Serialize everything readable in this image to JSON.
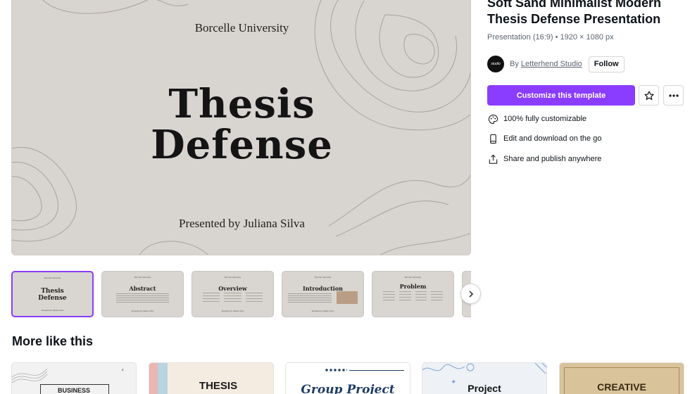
{
  "preview": {
    "university": "Borcelle University",
    "title_line1": "Thesis",
    "title_line2": "Defense",
    "presenter": "Presented by Juliana Silva"
  },
  "thumbnails": [
    {
      "header": "Borcelle University",
      "title": "Thesis Defense",
      "footer": "Presented by Juliana Silva",
      "active": true
    },
    {
      "header": "Borcelle University",
      "title": "Abstract",
      "footer": "Presented by Juliana Silva"
    },
    {
      "header": "Borcelle University",
      "title": "Overview",
      "footer": "Presented by Juliana Silva"
    },
    {
      "header": "Borcelle University",
      "title": "Introduction",
      "footer": "Presented by Juliana Silva"
    },
    {
      "header": "Borcelle University",
      "title": "Problem",
      "footer": ""
    }
  ],
  "more": {
    "heading": "More like this",
    "cards": [
      {
        "label": "BUSINESS",
        "bg": "#f2f2f2",
        "color": "#222222"
      },
      {
        "label": "THESIS",
        "bg": "#f4ece1",
        "color": "#1a1a1a"
      },
      {
        "label": "Group Project",
        "bg": "#ffffff",
        "color": "#1f3c66"
      },
      {
        "label": "Project",
        "bg": "#eef1f6",
        "color": "#111111"
      },
      {
        "label": "CREATIVE",
        "bg": "#d9c39a",
        "color": "#3a2a12"
      }
    ]
  },
  "template": {
    "title": "Soft Sand Minimalist Modern Thesis Defense Presentation",
    "meta": "Presentation (16:9) • 1920 × 1080 px",
    "by_prefix": "By",
    "author": "Letterhend Studio",
    "follow": "Follow",
    "customize": "Customize this template",
    "star_icon": "star-icon",
    "more_icon": "more-horizontal-icon"
  },
  "features": [
    {
      "icon": "palette-icon",
      "label": "100% fully customizable"
    },
    {
      "icon": "mobile-icon",
      "label": "Edit and download on the go"
    },
    {
      "icon": "share-icon",
      "label": "Share and publish anywhere"
    }
  ],
  "colors": {
    "accent": "#8b3dff",
    "slide_bg": "#d8d4cf"
  }
}
